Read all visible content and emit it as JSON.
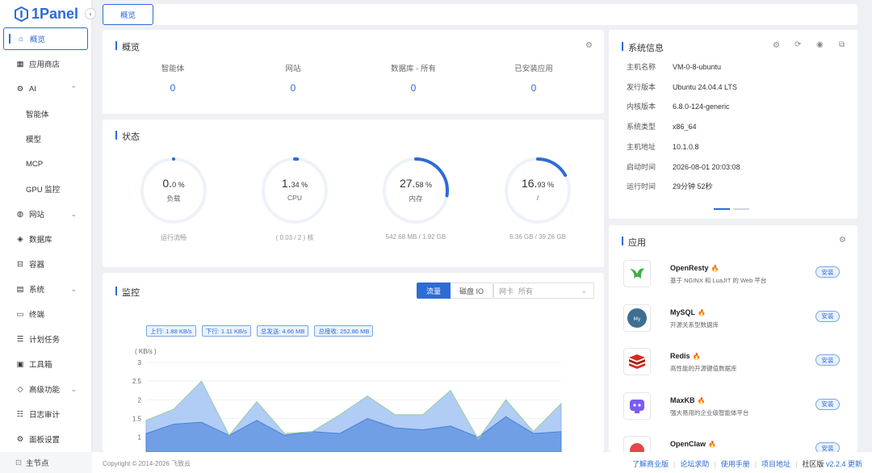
{
  "brand": {
    "name": "1Panel",
    "color": "#2d6bd6"
  },
  "sidebar": {
    "items": [
      {
        "label": "概览",
        "icon": "home-icon",
        "active": true
      },
      {
        "label": "应用商店",
        "icon": "grid-icon"
      },
      {
        "label": "AI",
        "icon": "robot-icon",
        "expanded": true
      },
      {
        "label": "智能体",
        "sub": true
      },
      {
        "label": "模型",
        "sub": true
      },
      {
        "label": "MCP",
        "sub": true
      },
      {
        "label": "GPU 监控",
        "sub": true
      },
      {
        "label": "网站",
        "icon": "globe-icon",
        "chev": true
      },
      {
        "label": "数据库",
        "icon": "layers-icon"
      },
      {
        "label": "容器",
        "icon": "container-icon"
      },
      {
        "label": "系统",
        "icon": "system-icon",
        "chev": true
      },
      {
        "label": "终端",
        "icon": "terminal-icon"
      },
      {
        "label": "计划任务",
        "icon": "task-icon"
      },
      {
        "label": "工具箱",
        "icon": "toolbox-icon"
      },
      {
        "label": "高级功能",
        "icon": "diamond-icon",
        "chev": true
      },
      {
        "label": "日志审计",
        "icon": "log-icon"
      },
      {
        "label": "面板设置",
        "icon": "gear-icon"
      }
    ],
    "bottom": "主节点"
  },
  "topbar": {
    "tab": "概览"
  },
  "overview": {
    "title": "概览",
    "stats": [
      {
        "label": "智能体",
        "value": "0"
      },
      {
        "label": "网站",
        "value": "0"
      },
      {
        "label": "数据库 - 所有",
        "value": "0"
      },
      {
        "label": "已安装应用",
        "value": "0"
      }
    ]
  },
  "status": {
    "title": "状态",
    "gauges": [
      {
        "int": "0.",
        "dec": "0",
        "name": "负载",
        "sub": "运行流畅",
        "percent": 0
      },
      {
        "int": "1.",
        "dec": "34",
        "name": "CPU",
        "sub": "( 0.03 / 2 ) 核",
        "percent": 1.34
      },
      {
        "int": "27.",
        "dec": "58",
        "name": "内存",
        "sub": "542.68 MB / 1.92 GB",
        "percent": 27.58
      },
      {
        "int": "16.",
        "dec": "93",
        "name": "/",
        "sub": "6.36 GB / 39.26 GB",
        "percent": 16.93
      }
    ],
    "unit": "%"
  },
  "monitor": {
    "title": "监控",
    "seg": [
      "流量",
      "磁盘 IO"
    ],
    "nic_label": "网卡",
    "nic_value": "所有",
    "tags": [
      "上行: 1.88 KB/s",
      "下行: 1.11 KB/s",
      "总发送: 4.66 MB",
      "总接收: 252.86 MB"
    ],
    "unit": "( KB/s )"
  },
  "chart_data": {
    "type": "area",
    "ylabel": "( KB/s )",
    "ylim": [
      0.8,
      3
    ],
    "yticks": [
      "3",
      "2.5",
      "2",
      "1.5",
      "1"
    ],
    "series": [
      {
        "values": [
          1.45,
          1.75,
          2.5,
          1.05,
          1.95,
          1.1,
          1.15,
          1.6,
          2.1,
          1.6,
          1.6,
          2.25,
          0.95,
          2.0,
          1.15,
          1.9
        ]
      },
      {
        "values": [
          1.1,
          1.35,
          1.4,
          1.05,
          1.45,
          1.05,
          1.15,
          1.1,
          1.5,
          1.25,
          1.2,
          1.3,
          1.0,
          1.55,
          1.1,
          1.15
        ]
      }
    ],
    "colors": [
      "#a9c8f5",
      "#5b8fe0"
    ]
  },
  "sysinfo": {
    "title": "系统信息",
    "rows": [
      {
        "k": "主机名称",
        "v": "VM-0-8-ubuntu"
      },
      {
        "k": "发行版本",
        "v": "Ubuntu 24.04.4 LTS"
      },
      {
        "k": "内核版本",
        "v": "6.8.0-124-generic"
      },
      {
        "k": "系统类型",
        "v": "x86_64"
      },
      {
        "k": "主机地址",
        "v": "10.1.0.8"
      },
      {
        "k": "启动时间",
        "v": "2026-08-01 20:03:08"
      },
      {
        "k": "运行时间",
        "v": "29分钟 52秒"
      }
    ]
  },
  "apps": {
    "title": "应用",
    "install_label": "安装",
    "items": [
      {
        "name": "OpenResty",
        "desc": "基于 NGINX 和 LuaJIT 的 Web 平台",
        "icon": "openresty-icon"
      },
      {
        "name": "MySQL",
        "desc": "开源关系型数据库",
        "icon": "mysql-icon"
      },
      {
        "name": "Redis",
        "desc": "高性能的开源键值数据库",
        "icon": "redis-icon"
      },
      {
        "name": "MaxKB",
        "desc": "强大易用的企业级智能体平台",
        "icon": "maxkb-icon"
      },
      {
        "name": "OpenClaw",
        "desc": "",
        "icon": "openclaw-icon"
      }
    ]
  },
  "footer": {
    "copyright": "Copyright © 2014-2026 飞致云",
    "links": [
      "了解商业版",
      "论坛求助",
      "使用手册",
      "项目地址"
    ],
    "edition": "社区版",
    "version": "v2.2.4",
    "update": "更新"
  }
}
